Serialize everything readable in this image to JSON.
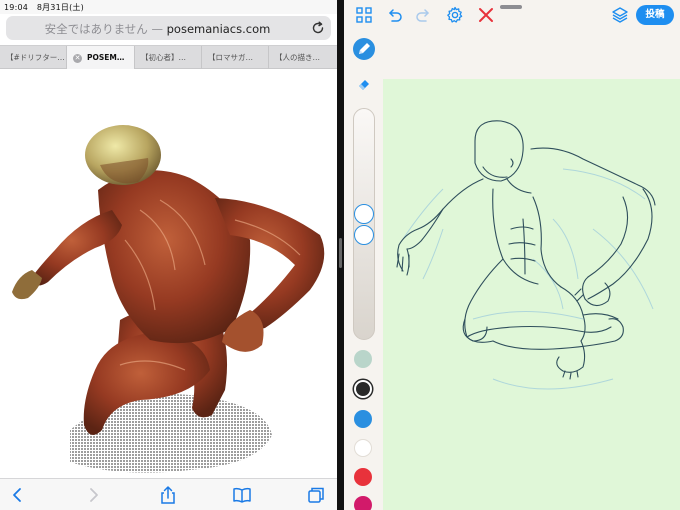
{
  "status_bar": {
    "time": "19:04",
    "date": "8月31日(土)"
  },
  "safari": {
    "address": {
      "security_warning": "安全ではありません",
      "separator": " — ",
      "domain": "posemaniacs.com"
    },
    "tabs": [
      {
        "label": "【#ドリフター…",
        "active": false
      },
      {
        "label": "POSEM…",
        "active": true
      },
      {
        "label": "【初心者】…",
        "active": false
      },
      {
        "label": "【ロマサガ…",
        "active": false
      },
      {
        "label": "【人の描き…",
        "active": false
      }
    ],
    "toolbar": [
      "back-icon",
      "forward-icon",
      "share-icon",
      "bookmarks-icon",
      "tabs-icon"
    ]
  },
  "drawing_app": {
    "post_button_label": "投稿",
    "toolbar_icons": [
      "grid-icon",
      "undo-icon",
      "redo-icon",
      "settings-icon",
      "close-icon",
      "layers-icon"
    ],
    "brush_size_level": 0.45,
    "opacity_level": 0.55,
    "colors": {
      "accent": "#1e8ef0",
      "canvas": "#e0f7d8",
      "swatches": [
        "#b9d5ca",
        "#2a2a2a",
        "#2a8fe0",
        "#ffffff",
        "#e8323b",
        "#d21a6a"
      ],
      "selected_swatch": 1
    }
  }
}
